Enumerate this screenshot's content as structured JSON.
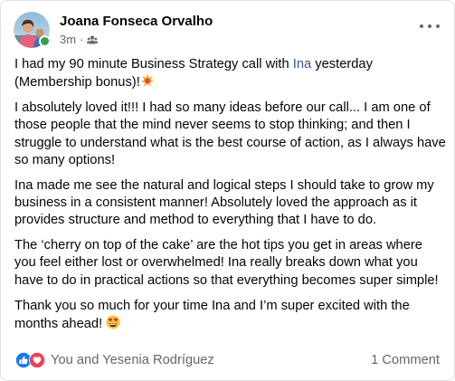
{
  "post": {
    "author": "Joana Fonseca Orvalho",
    "time": "3m",
    "separator": "·",
    "privacy_icon": "group-icon",
    "online": true,
    "paragraphs": [
      {
        "before": "I had my 90 minute Business Strategy call with ",
        "mention": "Ina",
        "after": " yesterday (Membership bonus)!"
      },
      {
        "text": "I absolutely loved it!!! I had so many ideas before our call... I am one of those people that the mind never seems to stop thinking; and then I struggle to understand what is the best course of action, as I always have so many options!"
      },
      {
        "text": "Ina made me see the natural and logical steps I should take to grow my business in a consistent manner! Absolutely loved the approach as it provides structure and method to everything that I have to do."
      },
      {
        "text": "The ‘cherry on top of the cake’ are the hot tips you get in areas where you feel either lost or overwhelmed! Ina really breaks down what you have to do in practical actions so that everything becomes super simple!"
      },
      {
        "text": "Thank you so much for your time Ina and I’m super excited with the months ahead! "
      }
    ],
    "emoji_1": "collision-emoji",
    "emoji_2": "heart-eyes-emoji"
  },
  "footer": {
    "reactions_text": "You and Yesenia Rodríguez",
    "reaction_icons": [
      "like-icon",
      "heart-icon"
    ],
    "comments_text": "1 Comment"
  },
  "colors": {
    "mention": "#385898",
    "secondary_text": "#65676b",
    "like_blue": "#1877f2",
    "love_red": "#f33e58",
    "online_green": "#31a24c"
  }
}
